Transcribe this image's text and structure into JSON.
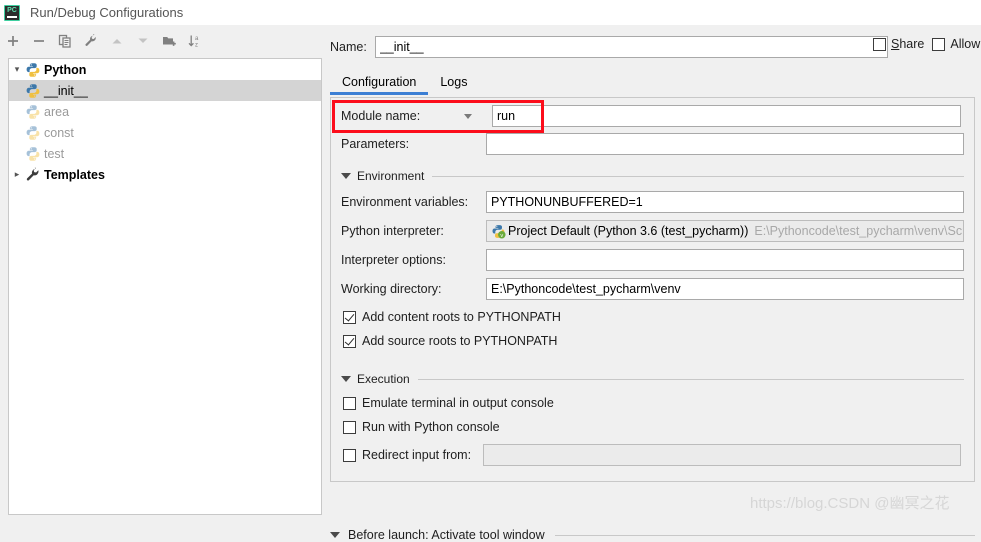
{
  "window": {
    "title": "Run/Debug Configurations",
    "app_icon": "pycharm-logo-icon",
    "logo_text": "PC"
  },
  "toolbar": {
    "buttons": [
      {
        "name": "add-configuration-button",
        "icon": "plus-icon",
        "label": "+",
        "enabled": true
      },
      {
        "name": "remove-configuration-button",
        "icon": "minus-icon",
        "label": "−",
        "enabled": true
      },
      {
        "name": "copy-configuration-button",
        "icon": "copy-icon",
        "label": "Copy",
        "enabled": true
      },
      {
        "name": "edit-templates-button",
        "icon": "wrench-icon",
        "label": "Edit Templates",
        "enabled": true
      },
      {
        "name": "move-up-button",
        "icon": "arrow-up-icon",
        "label": "Move Up",
        "enabled": false
      },
      {
        "name": "move-down-button",
        "icon": "arrow-down-icon",
        "label": "Move Down",
        "enabled": false
      },
      {
        "name": "move-into-folder-button",
        "icon": "folder-add-icon",
        "label": "Create Folder",
        "enabled": true
      },
      {
        "name": "sort-configurations-button",
        "icon": "sort-az-icon",
        "label": "Sort Alphabetically",
        "enabled": true
      }
    ]
  },
  "tree": {
    "items": [
      {
        "label": "Python",
        "icon": "python-icon",
        "expanded": true,
        "level": 0,
        "bold": true,
        "dim": false,
        "selected": false
      },
      {
        "label": "__init__",
        "icon": "python-icon",
        "level": 1,
        "bold": false,
        "dim": false,
        "selected": true
      },
      {
        "label": "area",
        "icon": "python-icon",
        "level": 1,
        "bold": false,
        "dim": true,
        "selected": false
      },
      {
        "label": "const",
        "icon": "python-icon",
        "level": 1,
        "bold": false,
        "dim": true,
        "selected": false
      },
      {
        "label": "test",
        "icon": "python-icon",
        "level": 1,
        "bold": false,
        "dim": true,
        "selected": false
      },
      {
        "label": "Templates",
        "icon": "wrench-icon",
        "expanded": false,
        "level": 0,
        "bold": true,
        "dim": false,
        "selected": false
      }
    ]
  },
  "name_field": {
    "label": "Name:",
    "value": "__init__",
    "placeholder": ""
  },
  "options": {
    "share": {
      "label_pre": "S",
      "label_post": "hare",
      "checked": false
    },
    "allow_parallel": {
      "label": "Allow",
      "checked": false
    }
  },
  "tabs": [
    {
      "label": "Configuration",
      "active": true
    },
    {
      "label": "Logs",
      "active": false
    }
  ],
  "configuration": {
    "module_name": {
      "label": "Module name:",
      "value": "run"
    },
    "parameters": {
      "label": "Parameters:",
      "value": ""
    },
    "environment_section": {
      "label": "Environment",
      "expanded": true
    },
    "environment_variables": {
      "label": "Environment variables:",
      "value": "PYTHONUNBUFFERED=1"
    },
    "python_interpreter": {
      "label": "Python interpreter:",
      "value": "Project Default (Python 3.6 (test_pycharm))",
      "path_hint": "E:\\Pythoncode\\test_pycharm\\venv\\Scripts",
      "icon": "python-interpreter-icon"
    },
    "interpreter_options": {
      "label": "Interpreter options:",
      "value": ""
    },
    "working_directory": {
      "label": "Working directory:",
      "value": "E:\\Pythoncode\\test_pycharm\\venv"
    },
    "add_content_roots": {
      "label": "Add content roots to PYTHONPATH",
      "checked": true
    },
    "add_source_roots": {
      "label": "Add source roots to PYTHONPATH",
      "checked": true
    },
    "execution_section": {
      "label": "Execution",
      "expanded": true
    },
    "emulate_terminal": {
      "label": "Emulate terminal in output console",
      "checked": false
    },
    "run_with_python_console": {
      "label": "Run with Python console",
      "checked": false
    },
    "redirect_input": {
      "label": "Redirect input from:",
      "checked": false,
      "value": ""
    }
  },
  "before_launch": {
    "label": "Before launch: Activate tool window",
    "expanded": true
  },
  "annotation": {
    "highlight_color": "#fc0d1b",
    "target": "module-name-row"
  },
  "watermark": {
    "text": "https://blog.CSDN @幽冥之花"
  },
  "colors": {
    "accent": "#3c7fd4",
    "panel_bg": "#f0f0f0",
    "tree_bg": "#ffffff",
    "selection": "#d4d4d4",
    "disabled_text": "#9a9a9a"
  }
}
